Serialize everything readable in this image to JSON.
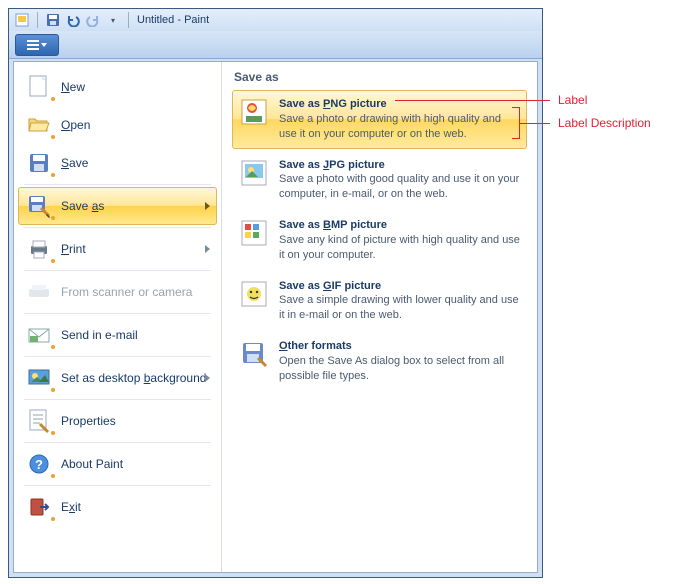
{
  "window": {
    "title": "Untitled - Paint"
  },
  "menu": {
    "items": [
      {
        "label": "New",
        "u": "N"
      },
      {
        "label": "Open",
        "u": "O"
      },
      {
        "label": "Save",
        "u": "S"
      },
      {
        "label": "Save as",
        "u": "a",
        "pre": "Save "
      },
      {
        "label": "Print",
        "u": "P"
      },
      {
        "label": "From scanner or camera"
      },
      {
        "label": "Send in e-mail"
      },
      {
        "label": "Set as desktop background",
        "u": "b",
        "pre": "Set as desktop "
      },
      {
        "label": "Properties"
      },
      {
        "label": "About Paint"
      },
      {
        "label": "Exit",
        "u": "x",
        "pre": "E"
      }
    ]
  },
  "submenu": {
    "title": "Save as",
    "items": [
      {
        "label_pre": "Save as ",
        "label_u": "P",
        "label_post": "NG picture",
        "desc": "Save a photo or drawing with high quality and use it on your computer or on the web."
      },
      {
        "label_pre": "Save as ",
        "label_u": "J",
        "label_post": "PG picture",
        "desc": "Save a photo with good quality and use it on your computer, in e-mail, or on the web."
      },
      {
        "label_pre": "Save as ",
        "label_u": "B",
        "label_post": "MP picture",
        "desc": "Save any kind of picture with high quality and use it on your computer."
      },
      {
        "label_pre": "Save as ",
        "label_u": "G",
        "label_post": "IF picture",
        "desc": "Save a simple drawing with lower quality and use it in e-mail or on the web."
      },
      {
        "label_pre": "",
        "label_u": "O",
        "label_post": "ther formats",
        "desc": "Open the Save As dialog box to select from all possible file types."
      }
    ]
  },
  "annotations": {
    "label": "Label",
    "desc": "Label Description"
  }
}
